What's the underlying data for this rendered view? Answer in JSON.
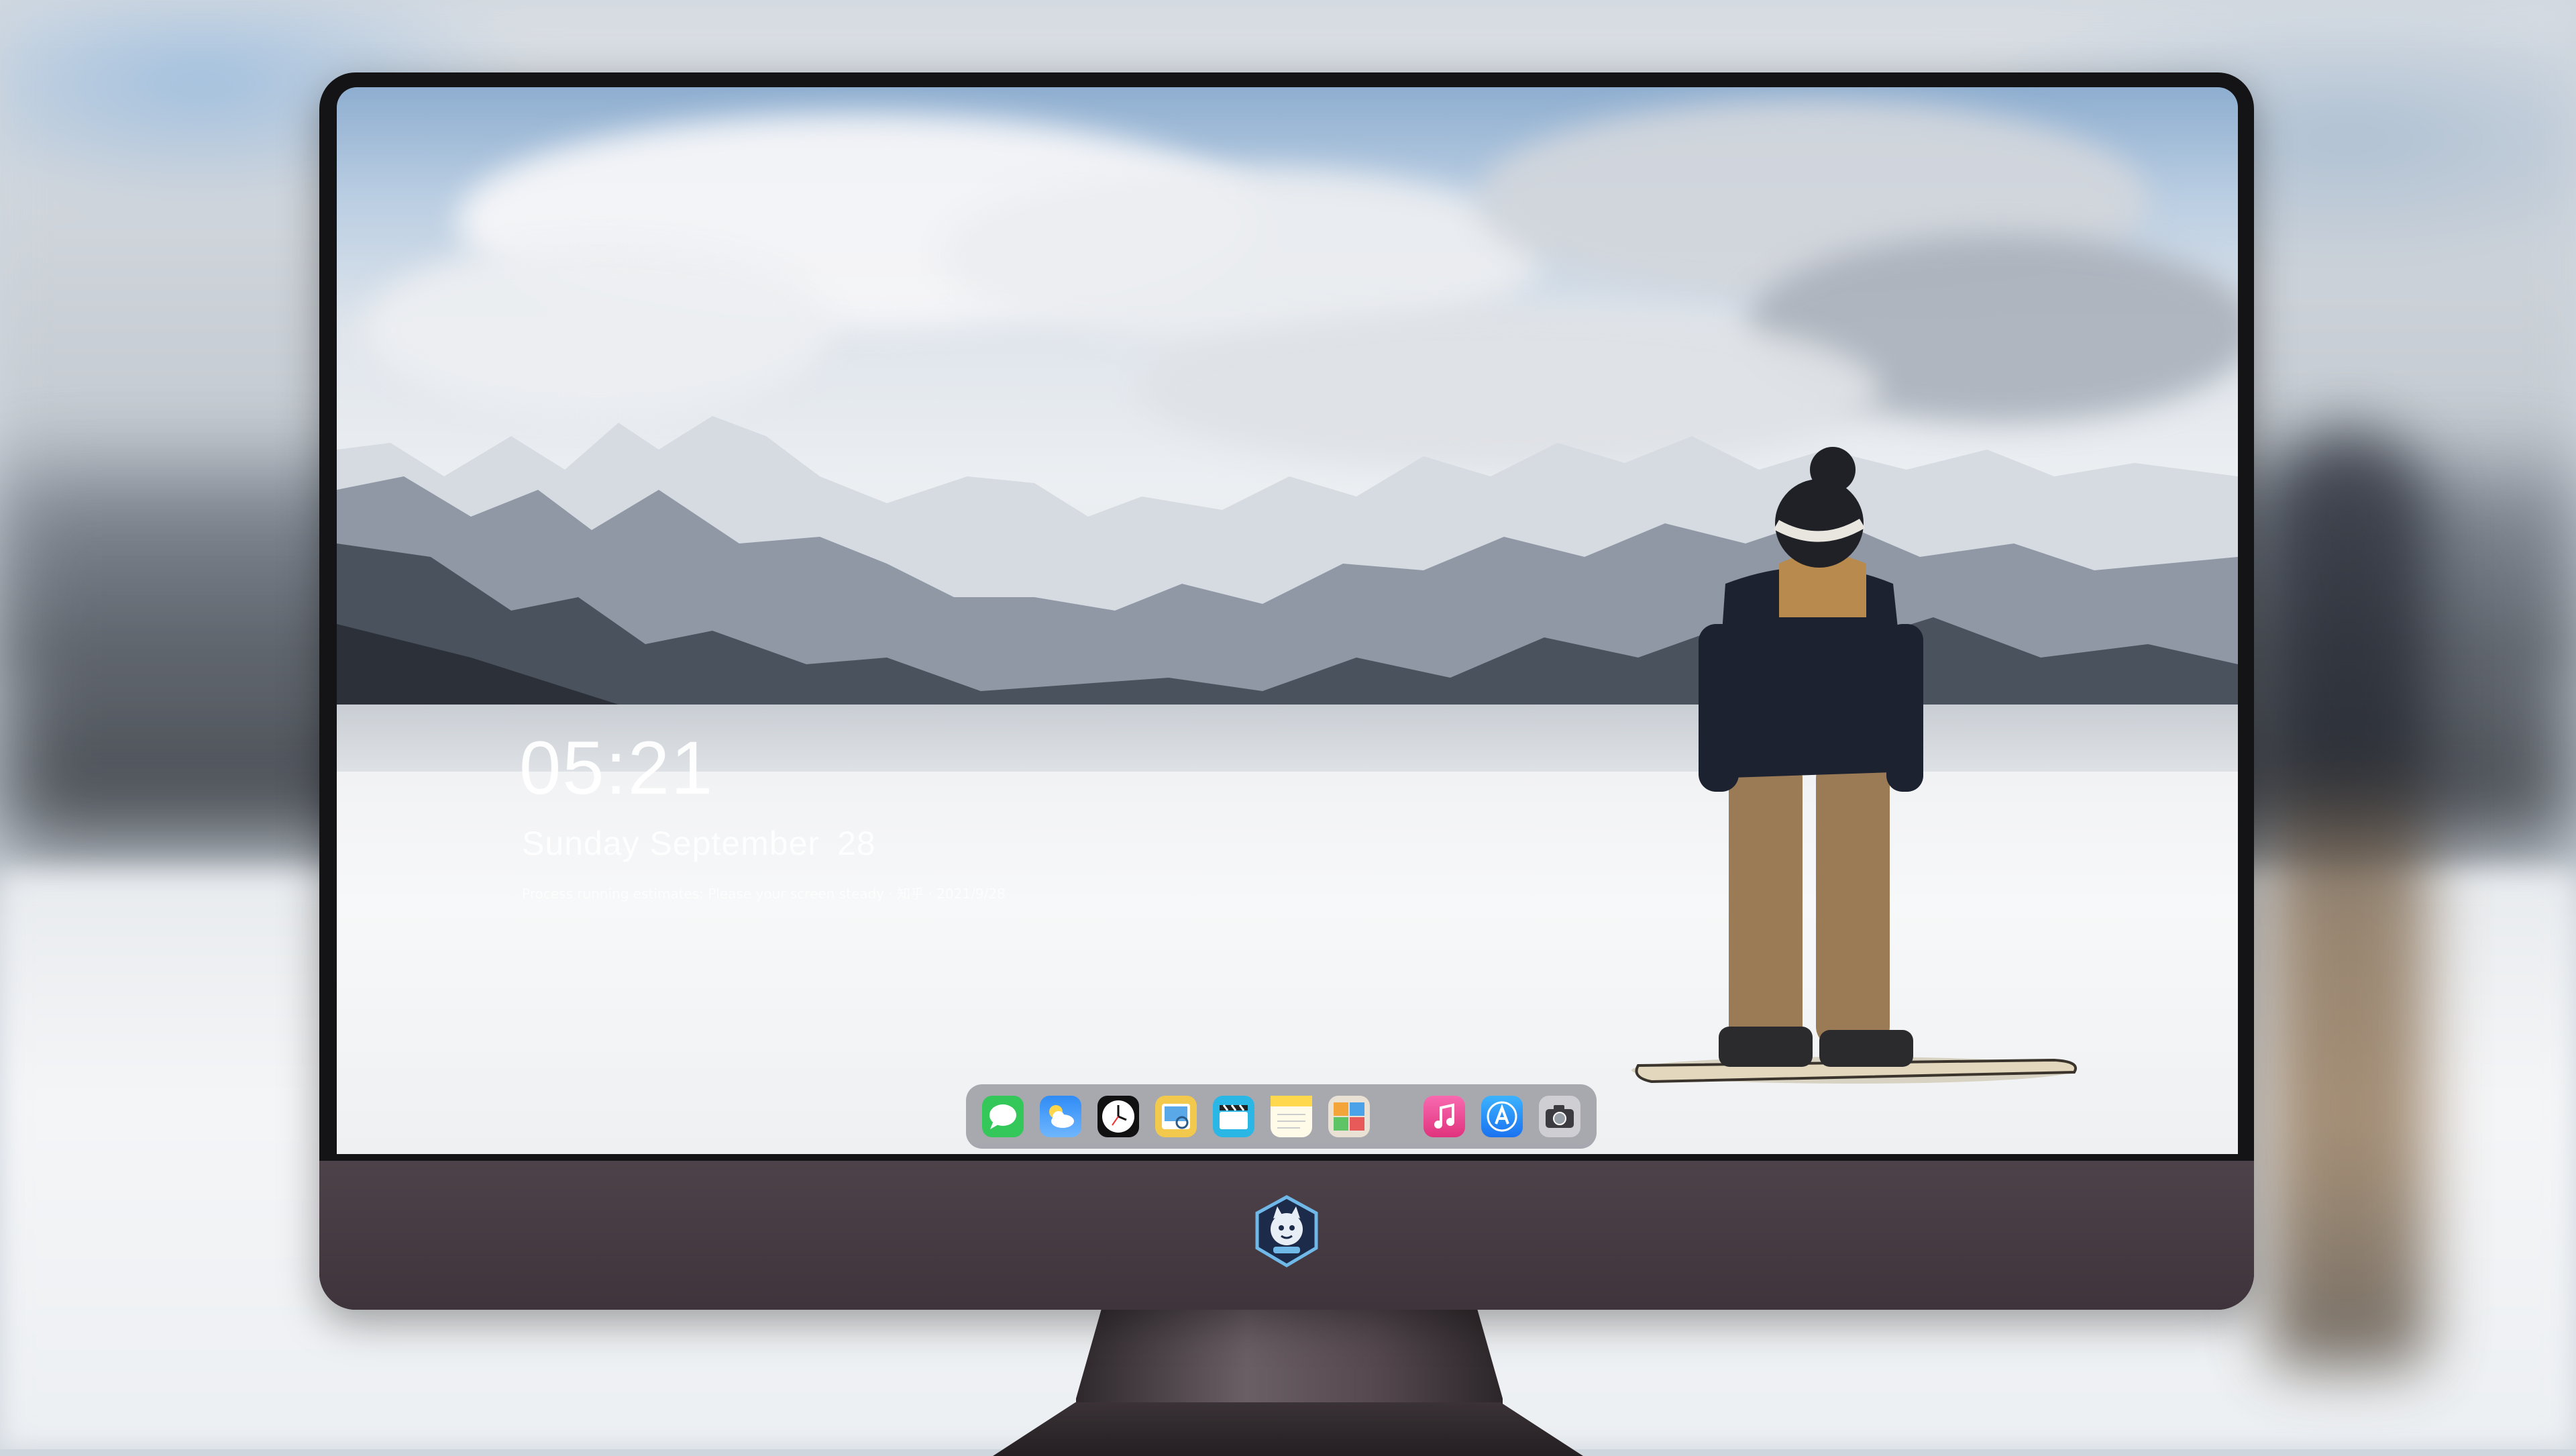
{
  "lock_screen": {
    "time": "05:21",
    "weekday_month": "Sunday September",
    "day": "28",
    "status_line": "Process running estimates: Please your screen steady · 知乎 · 2021/9/28"
  },
  "dock": {
    "apps": [
      {
        "name": "Messages",
        "icon": "messages-icon",
        "color": "#34c759"
      },
      {
        "name": "Weather",
        "icon": "weather-icon",
        "color": "#2f8cf5"
      },
      {
        "name": "Clock",
        "icon": "clock-icon",
        "color": "#111111"
      },
      {
        "name": "Preview",
        "icon": "preview-icon",
        "color": "#f2c94c"
      },
      {
        "name": "Clips",
        "icon": "clips-icon",
        "color": "#2ab7e6"
      },
      {
        "name": "Notes",
        "icon": "notes-icon",
        "color": "#ffd84d"
      },
      {
        "name": "Photo Booth",
        "icon": "photo-icon",
        "color": "#e9e2d4"
      },
      {
        "name": "Music",
        "icon": "music-icon",
        "color": "#f43f8d"
      },
      {
        "name": "App Store",
        "icon": "app-store-icon",
        "color": "#1a8cf6"
      },
      {
        "name": "Camera",
        "icon": "camera-icon",
        "color": "#cfcfd3"
      }
    ]
  },
  "colors": {
    "monitor_bezel": "#141416",
    "monitor_chin": "#4d4249",
    "dock_background": "#8c8c94"
  }
}
